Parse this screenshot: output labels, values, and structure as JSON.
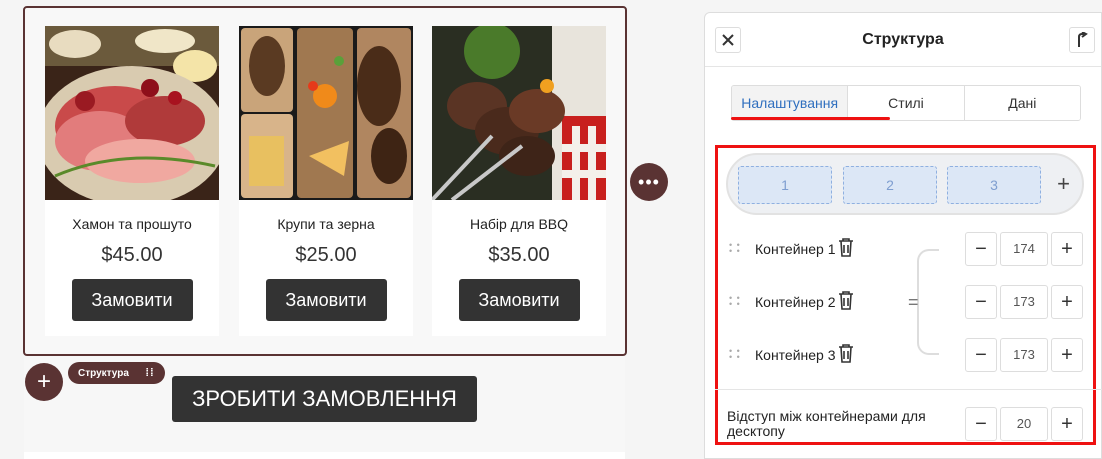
{
  "canvas": {
    "products": [
      {
        "name": "Хамон та прошуто",
        "price": "$45.00",
        "button": "Замовити",
        "image": "ham-platter"
      },
      {
        "name": "Крупи та зерна",
        "price": "$25.00",
        "button": "Замовити",
        "image": "grains-collage"
      },
      {
        "name": "Набір для BBQ",
        "price": "$35.00",
        "button": "Замовити",
        "image": "bbq-skewers"
      }
    ],
    "structure_tag": "Структура",
    "order_button": "ЗРОБИТИ ЗАМОВЛЕННЯ"
  },
  "panel": {
    "title": "Структура",
    "tabs": [
      "Налаштування",
      "Стилі",
      "Дані"
    ],
    "active_tab": "Налаштування",
    "columns": [
      "1",
      "2",
      "3"
    ],
    "containers": [
      {
        "label": "Контейнер 1",
        "value": "174"
      },
      {
        "label": "Контейнер 2",
        "value": "173"
      },
      {
        "label": "Контейнер 3",
        "value": "173"
      }
    ],
    "gap": {
      "label": "Відступ між контейнерами для десктопу",
      "value": "20"
    }
  },
  "colors": {
    "accent": "#5a3333",
    "highlight": "#e11111",
    "active_tab": "#2f6fbf",
    "button": "#333333"
  }
}
